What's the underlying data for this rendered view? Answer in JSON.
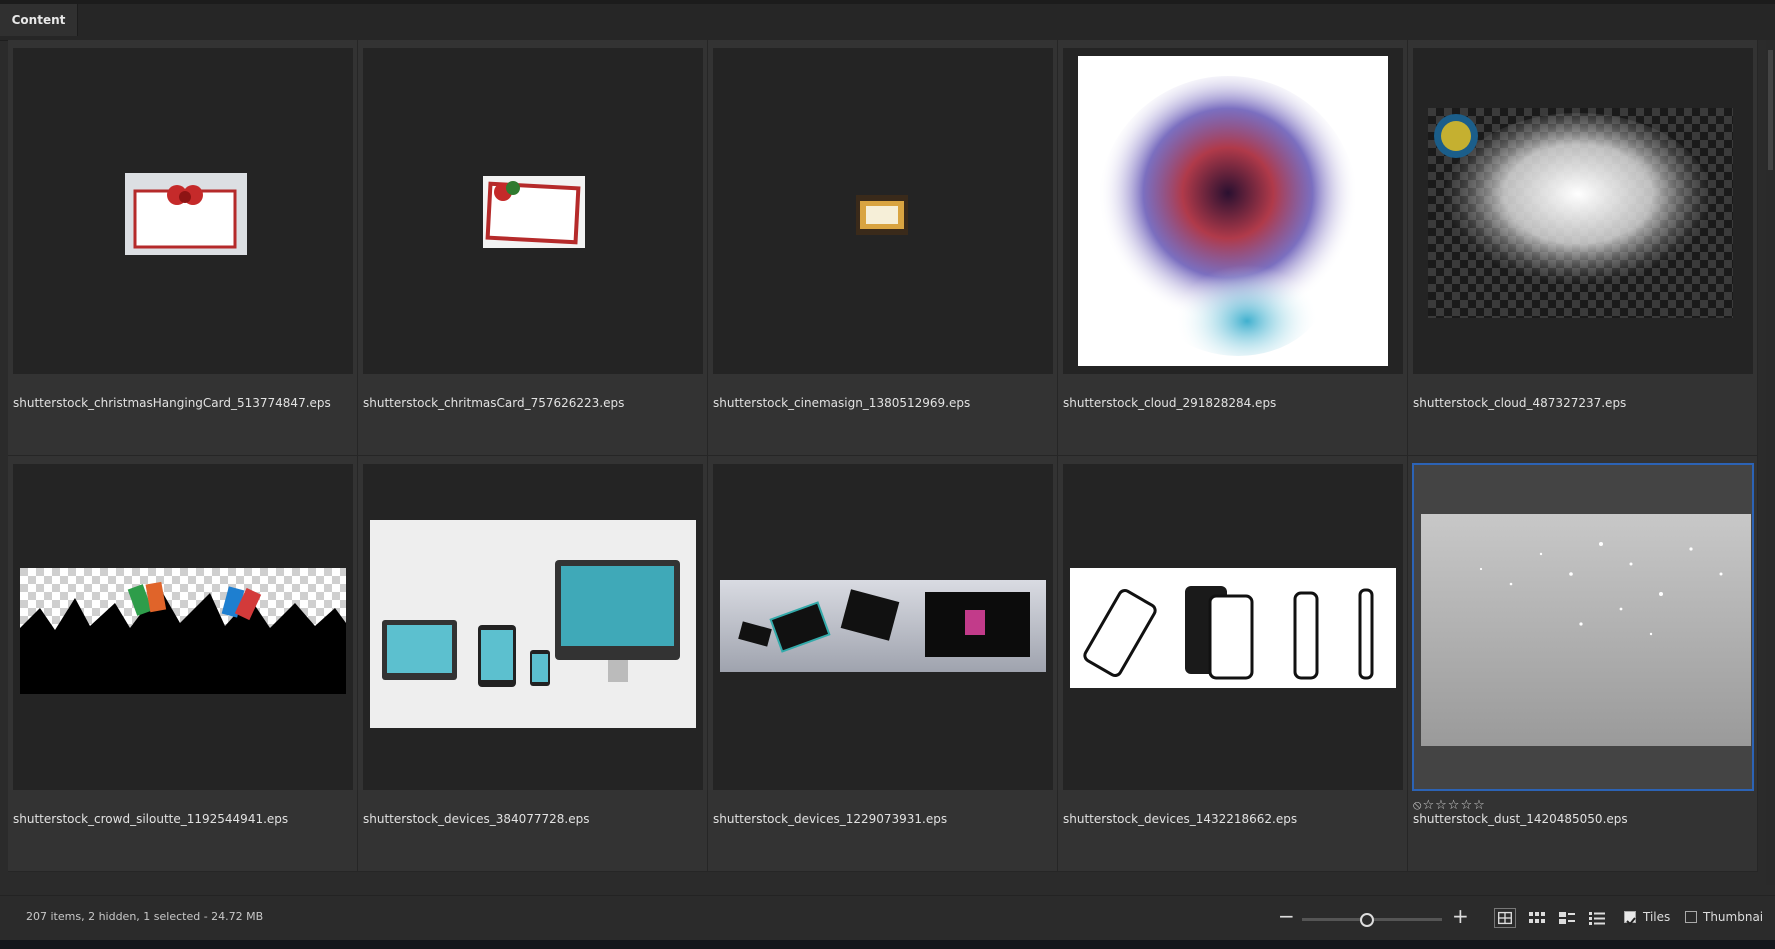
{
  "panel": {
    "tab_label": "Content"
  },
  "tiles": [
    {
      "name": "shutterstock_christmasHangingCard_513774847.eps"
    },
    {
      "name": "shutterstock_chritmasCard_757626223.eps"
    },
    {
      "name": "shutterstock_cinemasign_1380512969.eps"
    },
    {
      "name": "shutterstock_cloud_291828284.eps"
    },
    {
      "name": "shutterstock_cloud_487327237.eps"
    },
    {
      "name": "shutterstock_crowd_siloutte_1192544941.eps"
    },
    {
      "name": "shutterstock_devices_384077728.eps"
    },
    {
      "name": "shutterstock_devices_1229073931.eps"
    },
    {
      "name": "shutterstock_devices_1432218662.eps"
    },
    {
      "name": "shutterstock_dust_1420485050.eps",
      "selected": true,
      "rating": "⦸☆☆☆☆☆"
    }
  ],
  "status": {
    "summary": "207 items, 2 hidden, 1 selected - 24.72 MB",
    "zoom_out": "−",
    "zoom_in": "+",
    "zoom_level": 0.45
  },
  "view_options": {
    "tiles_label": "Tiles",
    "tiles_checked": true,
    "thumbnails_label": "Thumbnai",
    "thumbnails_checked": false
  },
  "colors": {
    "selection": "#2c63b5",
    "background": "#2b2b2b"
  }
}
